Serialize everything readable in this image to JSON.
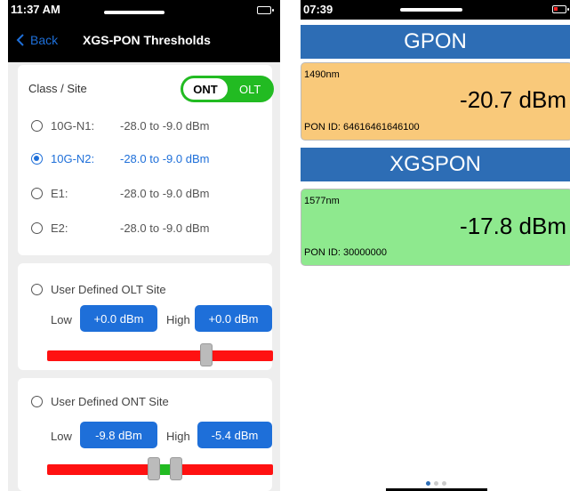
{
  "left": {
    "status_time": "11:37 AM",
    "back_label": "Back",
    "title": "XGS-PON Thresholds",
    "class_site_label": "Class / Site",
    "toggle": {
      "selected": "ONT",
      "other": "OLT"
    },
    "classes": [
      {
        "name": "10G-N1:",
        "range": "-28.0 to -9.0 dBm",
        "selected": false
      },
      {
        "name": "10G-N2:",
        "range": "-28.0 to -9.0 dBm",
        "selected": true
      },
      {
        "name": "E1:",
        "range": "-28.0 to -9.0 dBm",
        "selected": false
      },
      {
        "name": "E2:",
        "range": "-28.0 to -9.0 dBm",
        "selected": false
      }
    ],
    "olt_site": {
      "label": "User Defined OLT Site",
      "low_label": "Low",
      "low_value": "+0.0 dBm",
      "high_label": "High",
      "high_value": "+0.0 dBm"
    },
    "ont_site": {
      "label": "User Defined ONT Site",
      "low_label": "Low",
      "low_value": "-9.8 dBm",
      "high_label": "High",
      "high_value": "-5.4 dBm"
    }
  },
  "right": {
    "status_time": "07:39",
    "gpon": {
      "header": "GPON",
      "wavelength": "1490nm",
      "power": "-20.7 dBm",
      "pon_id": "PON ID: 64616461646100",
      "color": "#f9c97a"
    },
    "xgspon": {
      "header": "XGSPON",
      "wavelength": "1577nm",
      "power": "-17.8 dBm",
      "pon_id": "PON ID: 30000000",
      "color": "#8ee98e"
    },
    "page_count": 3,
    "active_page": 1
  },
  "colors": {
    "accent_blue": "#1e6fd9",
    "toggle_green": "#22bb22",
    "slider_red": "#ff1111",
    "header_blue": "#2d6db5"
  }
}
